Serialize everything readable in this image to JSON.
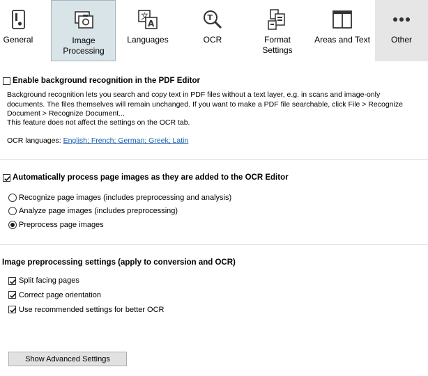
{
  "tabs": [
    {
      "id": "general",
      "label": "General",
      "icon": "toggle-switch-icon"
    },
    {
      "id": "image-processing",
      "label": "Image Processing",
      "icon": "image-camera-icon",
      "selected": true
    },
    {
      "id": "languages",
      "label": "Languages",
      "icon": "translate-icon"
    },
    {
      "id": "ocr",
      "label": "OCR",
      "icon": "magnifier-text-icon"
    },
    {
      "id": "format-settings",
      "label": "Format Settings",
      "icon": "format-documents-icon"
    },
    {
      "id": "areas-and-text",
      "label": "Areas and Text",
      "icon": "window-areas-icon"
    },
    {
      "id": "other",
      "label": "Other",
      "icon": "more-dots-icon"
    }
  ],
  "background_recognition": {
    "checkbox_label": "Enable background recognition in the PDF Editor",
    "checked": false,
    "description_1": "Background recognition lets you search and copy text in PDF files without a text layer, e.g. in scans and image-only documents. The files themselves will remain unchanged. If you want to make a PDF file searchable, click File > Recognize Document > Recognize Document...",
    "description_2": "This feature does not affect the settings on the OCR tab.",
    "ocr_languages_label": "OCR languages:",
    "ocr_languages_link": "English; French; German; Greek; Latin"
  },
  "auto_process": {
    "checkbox_label": "Automatically process page images as they are added to the OCR Editor",
    "checked": true,
    "options": [
      {
        "label": "Recognize page images (includes preprocessing and analysis)",
        "selected": false
      },
      {
        "label": "Analyze page images (includes preprocessing)",
        "selected": false
      },
      {
        "label": "Preprocess page images",
        "selected": true
      }
    ]
  },
  "preprocessing": {
    "heading": "Image preprocessing settings (apply to conversion and OCR)",
    "options": [
      {
        "label": "Split facing pages",
        "checked": true
      },
      {
        "label": "Correct page orientation",
        "checked": true
      },
      {
        "label": "Use recommended settings for better OCR",
        "checked": true
      }
    ]
  },
  "advanced_button": "Show Advanced Settings",
  "colors": {
    "selected_tab_bg": "#d9e4e8",
    "link": "#1b5fae"
  }
}
